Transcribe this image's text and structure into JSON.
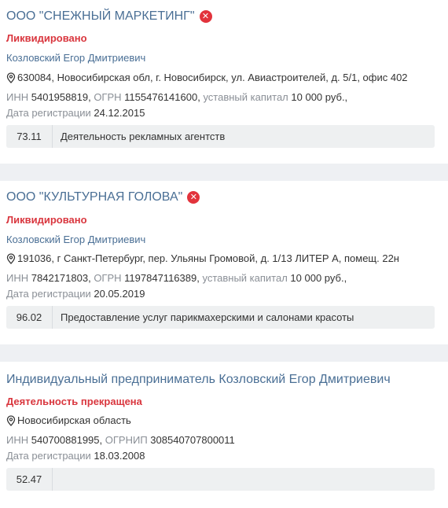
{
  "records": [
    {
      "title": "ООО \"СНЕЖНЫЙ МАРКЕТИНГ\"",
      "status": "Ликвидировано",
      "person": "Козловский Егор Дмитриевич",
      "address": "630084, Новосибирская обл, г. Новосибирск, ул. Авиастроителей, д. 5/1, офис 402",
      "inn_label": "ИНН",
      "inn": "5401958819",
      "ogrn_label": "ОГРН",
      "ogrn": "1155476141600",
      "capital_label": "уставный капитал",
      "capital": "10 000 руб.,",
      "reg_label": "Дата регистрации",
      "reg_date": "24.12.2015",
      "okved_code": "73.11",
      "okved_desc": "Деятельность рекламных агентств"
    },
    {
      "title": "ООО \"КУЛЬТУРНАЯ ГОЛОВА\"",
      "status": "Ликвидировано",
      "person": "Козловский Егор Дмитриевич",
      "address": "191036, г Санкт-Петербург, пер. Ульяны Громовой, д. 1/13 ЛИТЕР А, помещ. 22н",
      "inn_label": "ИНН",
      "inn": "7842171803",
      "ogrn_label": "ОГРН",
      "ogrn": "1197847116389",
      "capital_label": "уставный капитал",
      "capital": "10 000 руб.,",
      "reg_label": "Дата регистрации",
      "reg_date": "20.05.2019",
      "okved_code": "96.02",
      "okved_desc": "Предоставление услуг парикмахерскими и салонами красоты"
    },
    {
      "title": "Индивидуальный предприниматель Козловский Егор Дмитриевич",
      "status": "Деятельность прекращена",
      "address": "Новосибирская область",
      "inn_label": "ИНН",
      "inn": "540700881995",
      "ogrnip_label": "ОГРНИП",
      "ogrnip": "308540707800011",
      "reg_label": "Дата регистрации",
      "reg_date": "18.03.2008",
      "okved_code": "52.47",
      "okved_desc": ""
    }
  ],
  "icons": {
    "liquidated": "close-icon",
    "address": "location-pin-icon"
  },
  "colors": {
    "link": "#4a6f95",
    "status": "#d9363e",
    "badge": "#e2333c"
  }
}
